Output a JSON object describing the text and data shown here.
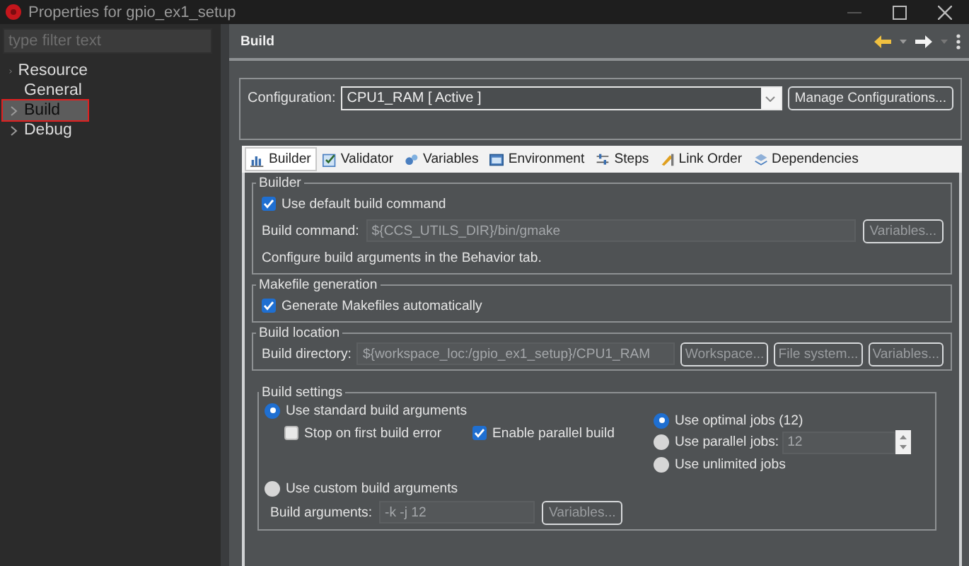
{
  "window": {
    "title": "Properties for gpio_ex1_setup"
  },
  "sidebar": {
    "filter": {
      "placeholder": "type filter text"
    },
    "items": [
      {
        "label": "Resource",
        "expandable": true,
        "selected": false
      },
      {
        "label": "General",
        "expandable": false,
        "selected": false
      },
      {
        "label": "Build",
        "expandable": true,
        "selected": true
      },
      {
        "label": "Debug",
        "expandable": true,
        "selected": false
      }
    ]
  },
  "page": {
    "title": "Build"
  },
  "configuration": {
    "label": "Configuration:",
    "value": "CPU1_RAM  [ Active ]",
    "button": {
      "label": "Manage Configurations...",
      "disabled": false
    }
  },
  "tabs": [
    {
      "label": "Builder",
      "selected": true
    },
    {
      "label": "Validator",
      "selected": false
    },
    {
      "label": "Variables",
      "selected": false
    },
    {
      "label": "Environment",
      "selected": false
    },
    {
      "label": "Steps",
      "selected": false
    },
    {
      "label": "Link Order",
      "selected": false
    },
    {
      "label": "Dependencies",
      "selected": false
    }
  ],
  "builder": {
    "title": "Builder",
    "use_default": {
      "label": "Use default build command",
      "checked": true
    },
    "command": {
      "label": "Build command:",
      "value": "${CCS_UTILS_DIR}/bin/gmake",
      "disabled": true
    },
    "buttons": [
      {
        "label": "Variables...",
        "disabled": true
      }
    ],
    "note": "Configure build arguments in the Behavior tab."
  },
  "makefile": {
    "title": "Makefile generation",
    "generate": {
      "label": "Generate Makefiles automatically",
      "checked": true
    }
  },
  "location": {
    "title": "Build location",
    "directory": {
      "label": "Build directory:",
      "value": "${workspace_loc:/gpio_ex1_setup}/CPU1_RAM",
      "disabled": true
    },
    "buttons": [
      {
        "label": "Workspace...",
        "disabled": true
      },
      {
        "label": "File system...",
        "disabled": true
      },
      {
        "label": "Variables...",
        "disabled": true
      }
    ]
  },
  "build_settings": {
    "title": "Build settings",
    "standard": {
      "label": "Use standard build arguments",
      "selected": true
    },
    "stop_on_error": {
      "label": "Stop on first build error",
      "checked": false
    },
    "parallel": {
      "label": "Enable parallel build",
      "checked": true
    },
    "jobs": [
      {
        "kind": "radio",
        "label": "Use optimal jobs (12)",
        "selected": true
      },
      {
        "kind": "spinner",
        "label": "Use parallel jobs:",
        "selected": false,
        "value": "12",
        "disabled": true
      },
      {
        "kind": "radio",
        "label": "Use unlimited jobs",
        "selected": false
      }
    ],
    "custom": {
      "label": "Use custom build arguments",
      "selected": false
    },
    "arguments": {
      "label": "Build arguments:",
      "value": "-k -j 12",
      "disabled": true
    },
    "buttons": [
      {
        "label": "Variables...",
        "disabled": true
      }
    ]
  }
}
